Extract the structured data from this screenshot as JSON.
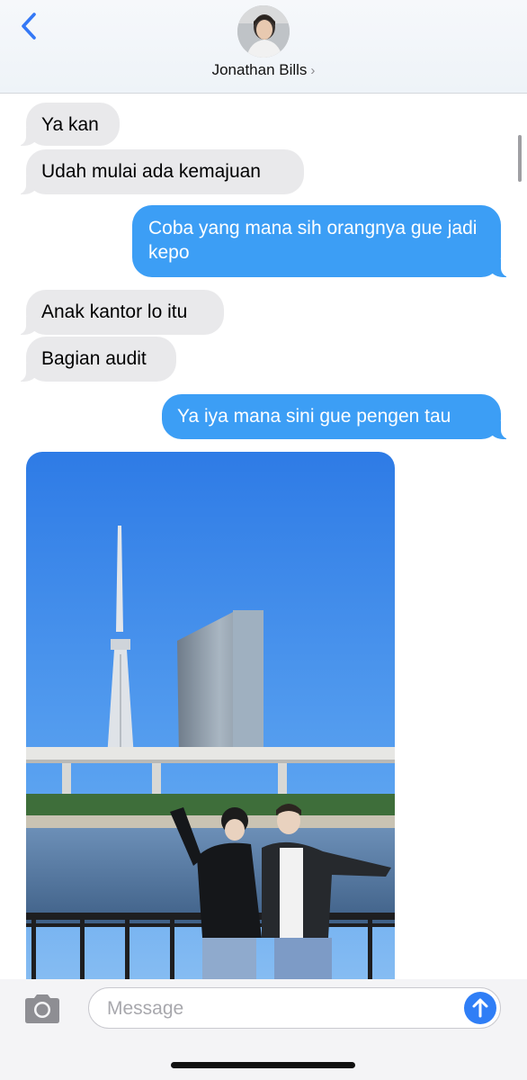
{
  "header": {
    "contact_name": "Jonathan Bills",
    "contact_chevron": "›",
    "back_icon": "chevron-left-icon",
    "accent_color": "#3478f6"
  },
  "conversation": {
    "messages": [
      {
        "direction": "received",
        "text": "Ya kan"
      },
      {
        "direction": "received",
        "text": "Udah mulai ada kemajuan"
      },
      {
        "direction": "sent",
        "text": "Coba yang mana sih orangnya gue jadi kepo"
      },
      {
        "direction": "received",
        "text": "Anak kantor lo itu"
      },
      {
        "direction": "received",
        "text": "Bagian audit"
      },
      {
        "direction": "sent",
        "text": "Ya iya mana sini gue pengen tau"
      }
    ],
    "attachment": {
      "type": "photo",
      "subject": "two people by river with tower and building"
    }
  },
  "composer": {
    "placeholder": "Message",
    "value": "",
    "camera_icon": "camera-icon",
    "send_icon": "arrow-up-icon"
  },
  "colors": {
    "sent_bubble": "#3c9ef5",
    "received_bubble": "#e9e9eb",
    "send_button": "#2f7ef6"
  }
}
